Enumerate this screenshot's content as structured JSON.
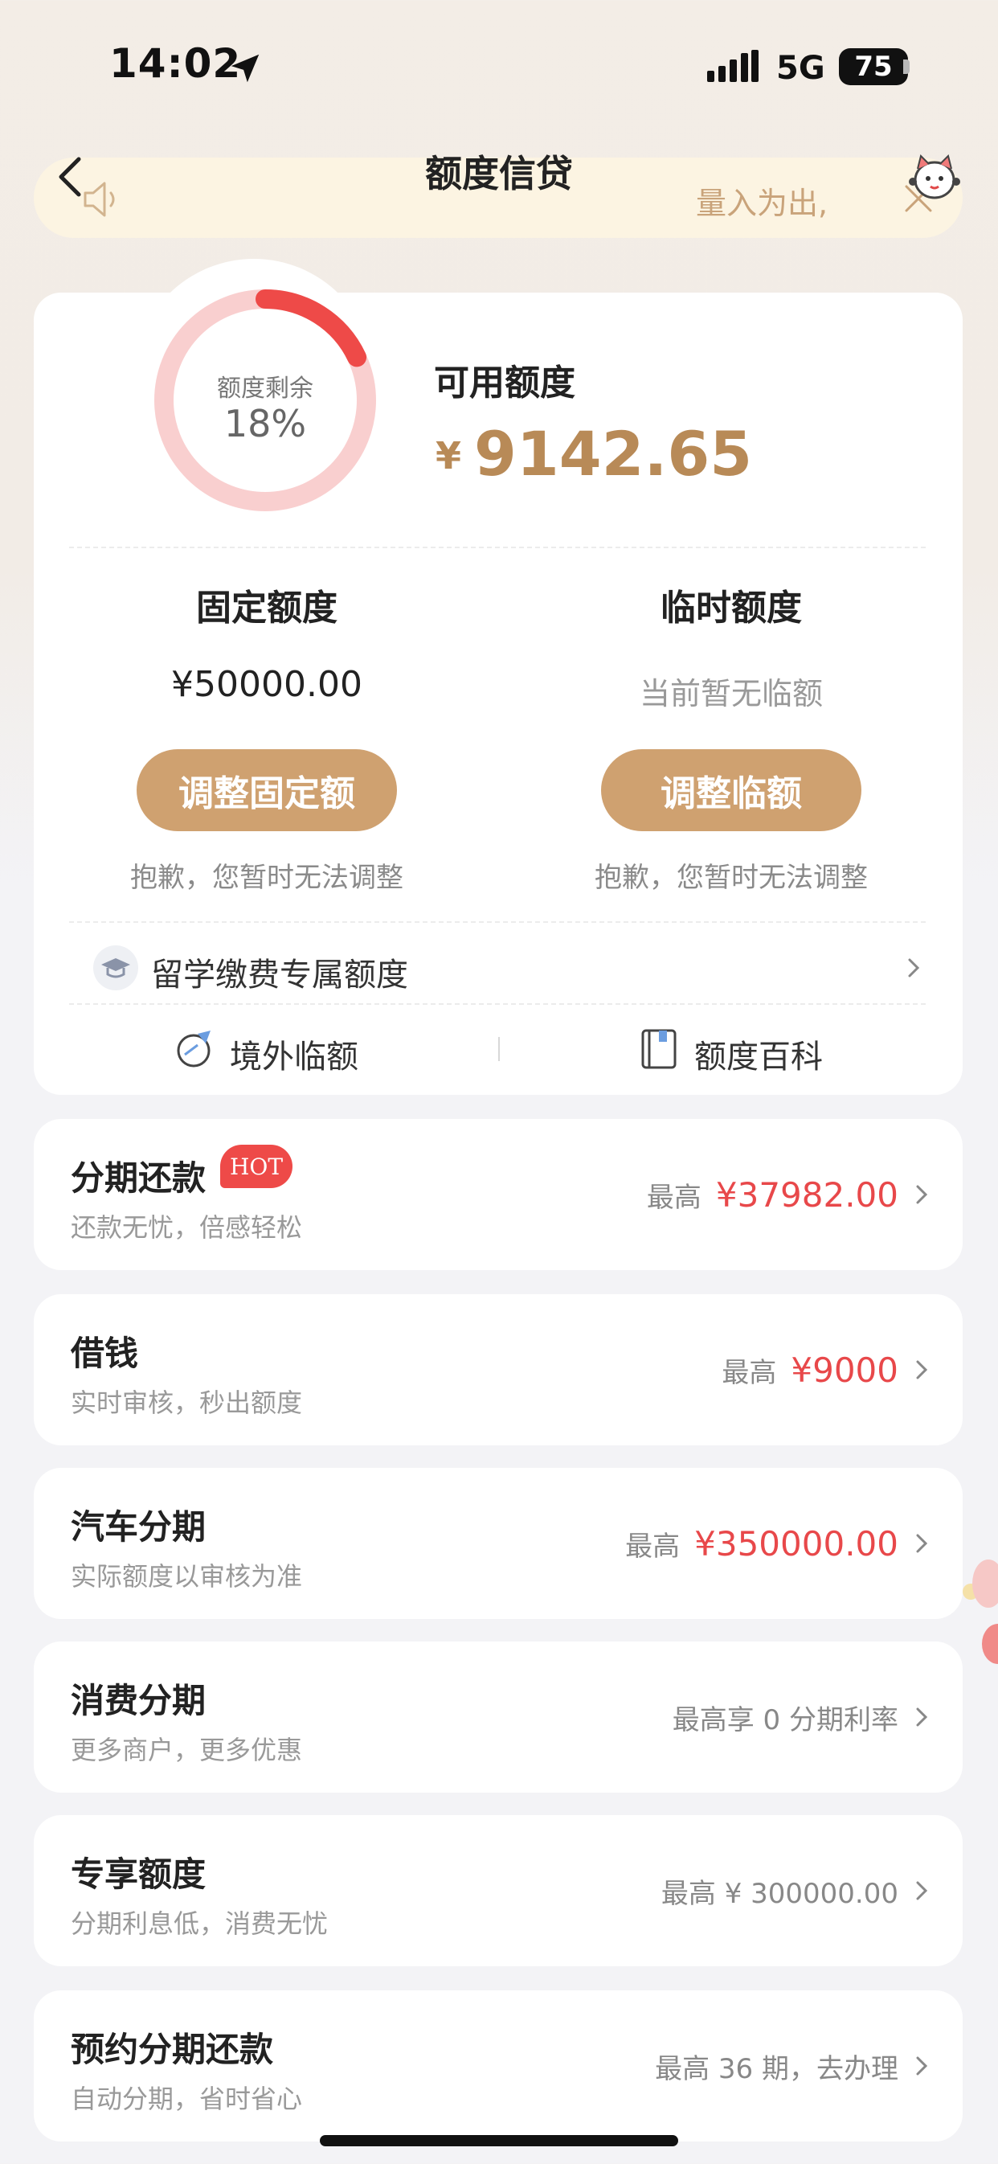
{
  "status_bar": {
    "time": "14:02",
    "network": "5G",
    "battery": "75"
  },
  "header": {
    "title": "额度信贷",
    "notice_text": "量入为出,"
  },
  "credit": {
    "ring_label": "额度剩余",
    "ring_percent": "18%",
    "ring_fraction": 0.18,
    "available_label": "可用额度",
    "available_currency": "¥",
    "available_value": "9142.65"
  },
  "fixed": {
    "title": "固定额度",
    "value": "¥50000.00",
    "button": "调整固定额",
    "note": "抱歉，您暂时无法调整"
  },
  "temp": {
    "title": "临时额度",
    "value": "当前暂无临额",
    "button": "调整临额",
    "note": "抱歉，您暂时无法调整"
  },
  "study": {
    "label": "留学缴费专属额度"
  },
  "links": {
    "overseas": "境外临额",
    "wiki": "额度百科"
  },
  "products": [
    {
      "title": "分期还款",
      "badge": "HOT",
      "subtitle": "还款无忧，倍感轻松",
      "max_label": "最高",
      "max_value": "¥37982.00"
    },
    {
      "title": "借钱",
      "subtitle": "实时审核，秒出额度",
      "max_label": "最高",
      "max_value": "¥9000"
    },
    {
      "title": "汽车分期",
      "subtitle": "实际额度以审核为准",
      "max_label": "最高",
      "max_value": "¥350000.00"
    },
    {
      "title": "消费分期",
      "subtitle": "更多商户，更多优惠",
      "right_text": "最高享 0 分期利率"
    },
    {
      "title": "专享额度",
      "subtitle": "分期利息低，消费无忧",
      "right_text": "最高 ¥ 300000.00"
    },
    {
      "title": "预约分期还款",
      "subtitle": "自动分期，省时省心",
      "right_text": "最高 36 期，去办理"
    }
  ],
  "colors": {
    "accent_gold": "#cfa170",
    "amount_gold": "#b88a57",
    "price_red": "#e8484a",
    "ring_red": "#ee4a48",
    "ring_track": "#f9cfcf",
    "notice_bg": "#fcf4e2"
  }
}
